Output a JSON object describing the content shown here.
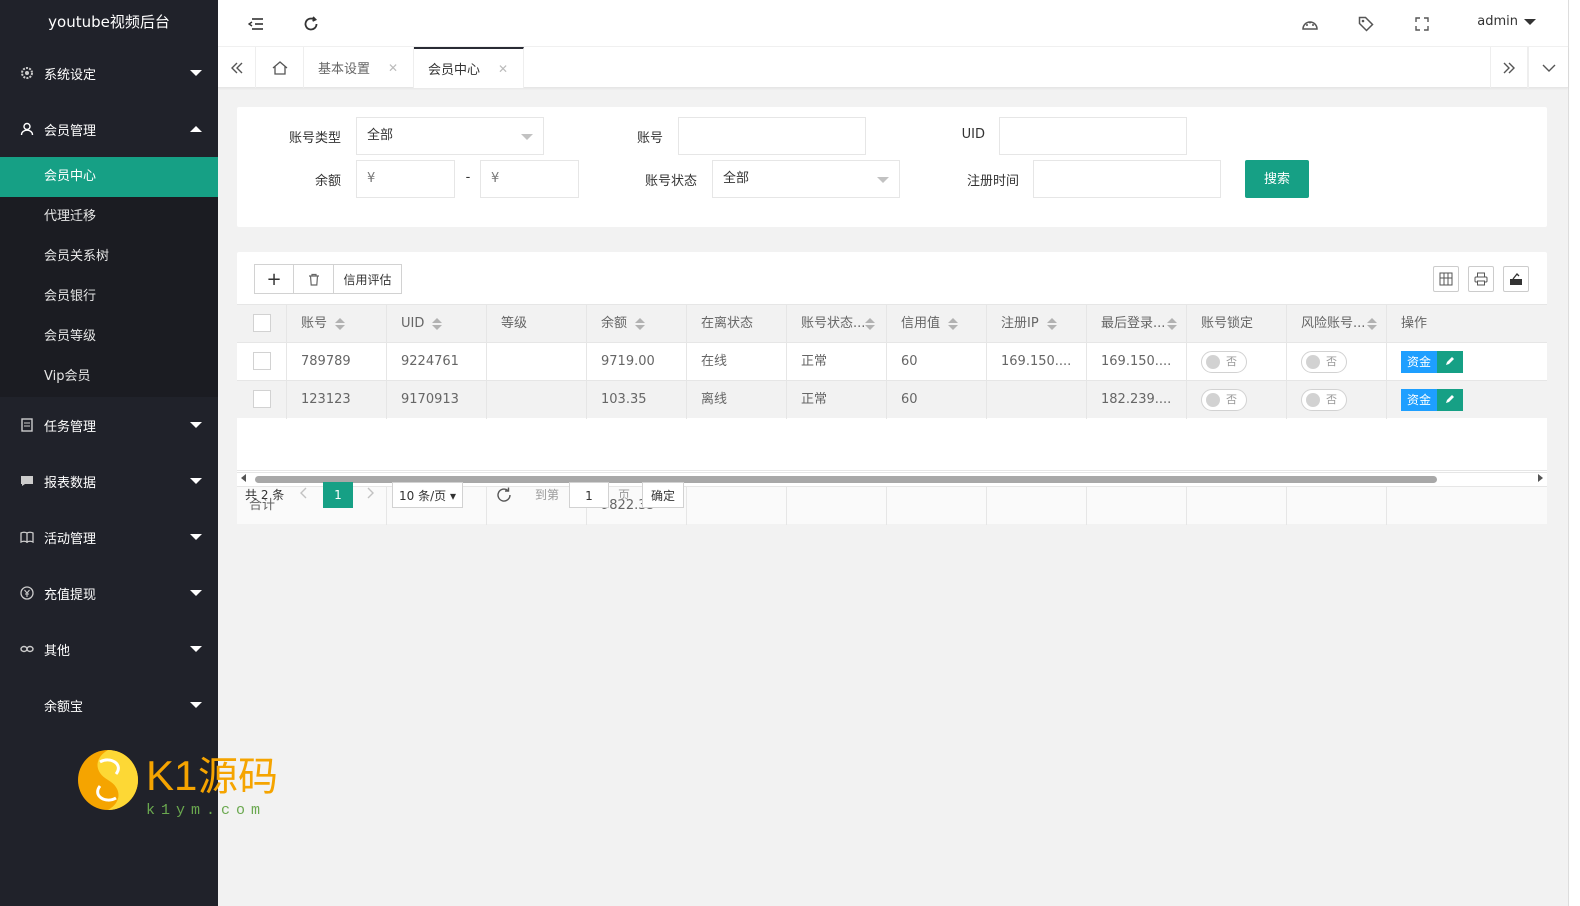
{
  "app": {
    "logo_text": "youtube视频后台"
  },
  "header": {
    "user": "admin"
  },
  "sidebar": {
    "groups": [
      {
        "label": "系统设定",
        "icon": "gear-icon"
      },
      {
        "label": "会员管理",
        "icon": "user-icon",
        "expanded": true,
        "children": [
          "会员中心",
          "代理迁移",
          "会员关系树",
          "会员银行",
          "会员等级",
          "Vip会员"
        ],
        "active": "会员中心"
      },
      {
        "label": "任务管理",
        "icon": "document-icon"
      },
      {
        "label": "报表数据",
        "icon": "chat-icon"
      },
      {
        "label": "活动管理",
        "icon": "book-icon"
      },
      {
        "label": "充值提现",
        "icon": "currency-icon"
      },
      {
        "label": "其他",
        "icon": "link-icon"
      },
      {
        "label": "余额宝",
        "icon": ""
      }
    ]
  },
  "watermark": {
    "brand": "K1源码",
    "url": "k1ym.com"
  },
  "tabs": [
    {
      "label": "基本设置",
      "active": false
    },
    {
      "label": "会员中心",
      "active": true
    }
  ],
  "search": {
    "account_type_label": "账号类型",
    "account_type_value": "全部",
    "account_label": "账号",
    "account_value": "",
    "uid_label": "UID",
    "uid_value": "",
    "balance_label": "余额",
    "balance_min_placeholder": "¥",
    "balance_sep": "-",
    "balance_max_placeholder": "¥",
    "status_label": "账号状态",
    "status_value": "全部",
    "reg_time_label": "注册时间",
    "reg_time_value": "",
    "search_button": "搜索"
  },
  "toolbar": {
    "add_label": "+",
    "credit_label": "信用评估"
  },
  "table": {
    "columns": [
      "账号",
      "UID",
      "等级",
      "余额",
      "在离状态",
      "账号状态...",
      "信用值",
      "注册IP",
      "最后登录...",
      "账号锁定",
      "风险账号...",
      "操作"
    ],
    "rows": [
      {
        "account": "789789",
        "uid": "9224761",
        "level": "",
        "balance": "9719.00",
        "online": "在线",
        "status": "正常",
        "credit": "60",
        "reg_ip": "169.150....",
        "last_login": "169.150....",
        "lock": "否",
        "risk": "否",
        "op_fund": "资金"
      },
      {
        "account": "123123",
        "uid": "9170913",
        "level": "",
        "balance": "103.35",
        "online": "离线",
        "status": "正常",
        "credit": "60",
        "reg_ip": "",
        "last_login": "182.239....",
        "lock": "否",
        "risk": "否",
        "op_fund": "资金"
      }
    ],
    "total_label": "合计",
    "total_balance": "9822.35"
  },
  "pager": {
    "total_text": "共 2 条",
    "current_page": "1",
    "page_size": "10 条/页",
    "goto_label": "到第",
    "goto_value": "1",
    "page_unit": "页",
    "confirm": "确定"
  },
  "colors": {
    "sidebar_bg": "#20222a",
    "accent": "#16a085",
    "blue": "#1e9fff"
  }
}
